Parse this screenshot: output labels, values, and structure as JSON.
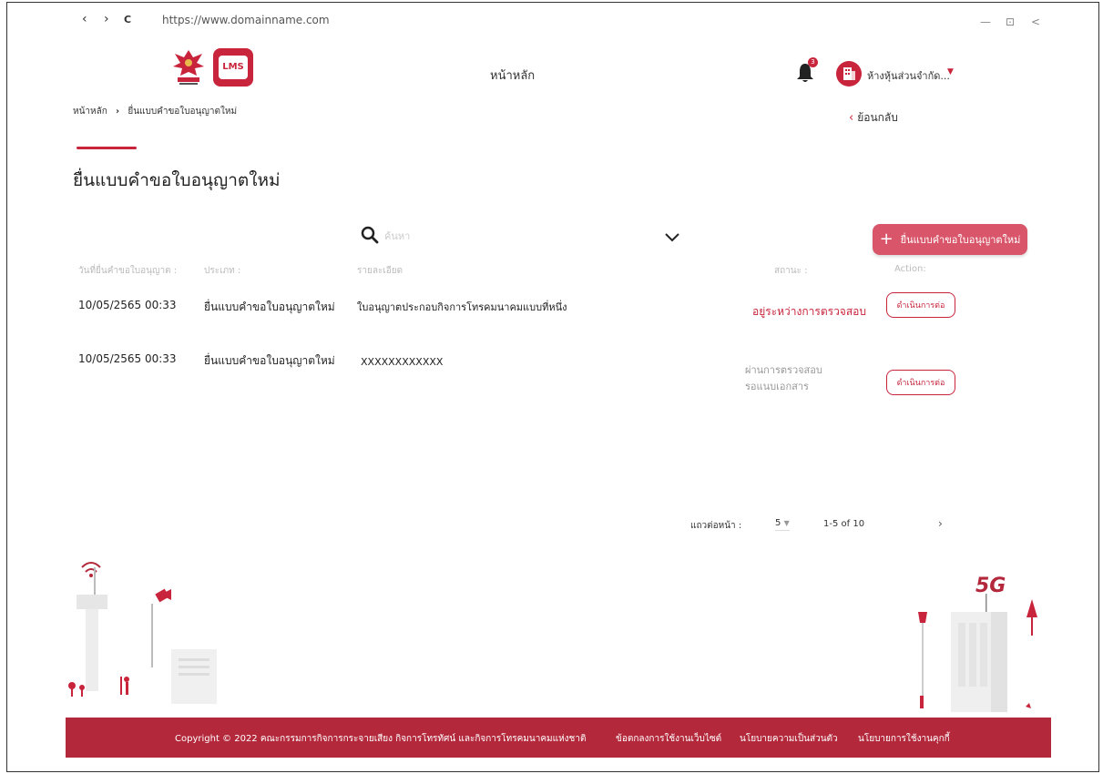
{
  "browser": {
    "url": "https://www.domainname.com",
    "back": "‹",
    "forward": "›",
    "reload": "C",
    "minimize": "—",
    "restore": "⊡",
    "close": "<"
  },
  "header": {
    "home_label": "หน้าหลัก",
    "notification_count": "3",
    "company_name": "ห้างหุ้นส่วนจำกัด..."
  },
  "breadcrumb": {
    "home": "หน้าหลัก",
    "separator": "›",
    "current": "ยื่นแบบคำขอใบอนุญาตใหม่"
  },
  "back_label": "ย้อนกลับ",
  "page_title": "ยื่นแบบคำขอใบอนุญาตใหม่",
  "search": {
    "placeholder": "ค้นหา"
  },
  "new_button_label": "ยื่นแบบคำขอใบอนุญาตใหม่",
  "table": {
    "headers": {
      "date": "วันที่ยื่นคำขอใบอนุญาต :",
      "type": "ประเภท :",
      "detail": "รายละเอียด",
      "status": "สถานะ :",
      "action": "Action:"
    },
    "rows": [
      {
        "date": "10/05/2565  00:33",
        "type": "ยื่นแบบคำขอใบอนุญาตใหม่",
        "detail": "ใบอนุญาตประกอบกิจการโทรคมนาคมแบบที่หนึ่ง",
        "status_line1": "อยู่ระหว่างการตรวจสอบ",
        "status_line2": "",
        "action": "ดำเนินการต่อ"
      },
      {
        "date": "10/05/2565  00:33",
        "type": "ยื่นแบบคำขอใบอนุญาตใหม่",
        "detail": "XXXXXXXXXXXX",
        "status_line1": "ผ่านการตรวจสอบ",
        "status_line2": "รอแนบเอกสาร",
        "action": "ดำเนินการต่อ"
      }
    ]
  },
  "pagination": {
    "rows_per_page_label": "แถวต่อหน้า :",
    "rows_per_page": "5",
    "range": "1-5 of 10",
    "next": "›"
  },
  "footer": {
    "copyright": "Copyright © 2022 คณะกรรมการกิจการกระจายเสียง กิจการโทรทัศน์ และกิจการโทรคมนาคมแห่งชาติ",
    "terms": "ข้อตกลงการใช้งานเว็บไซต์",
    "privacy": "นโยบายความเป็นส่วนตัว",
    "cookie": "นโยบายการใช้งานคุกกี้"
  },
  "illustration": {
    "label_5g": "5G"
  },
  "colors": {
    "accent": "#c8243b",
    "button": "#d9556a",
    "footer": "#b3283b"
  }
}
